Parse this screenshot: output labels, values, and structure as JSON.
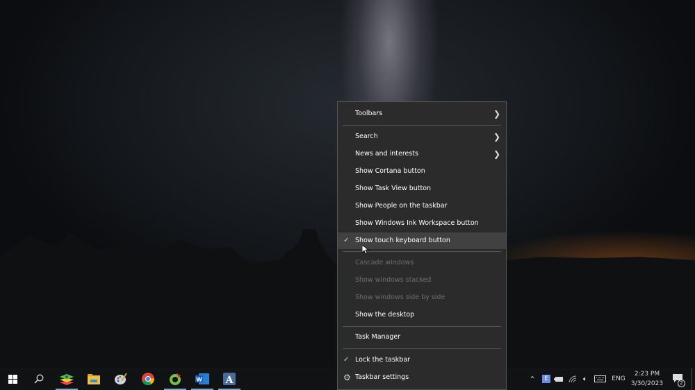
{
  "context_menu": {
    "items": [
      {
        "label": "Toolbars",
        "submenu": true
      },
      {
        "label": "Search",
        "submenu": true
      },
      {
        "label": "News and interests",
        "submenu": true
      },
      {
        "label": "Show Cortana button"
      },
      {
        "label": "Show Task View button"
      },
      {
        "label": "Show People on the taskbar"
      },
      {
        "label": "Show Windows Ink Workspace button"
      },
      {
        "label": "Show touch keyboard button",
        "checked": true,
        "highlighted": true
      },
      {
        "label": "Cascade windows",
        "disabled": true
      },
      {
        "label": "Show windows stacked",
        "disabled": true
      },
      {
        "label": "Show windows side by side",
        "disabled": true
      },
      {
        "label": "Show the desktop"
      },
      {
        "label": "Task Manager"
      },
      {
        "label": "Lock the taskbar",
        "checked": true
      },
      {
        "label": "Taskbar settings",
        "icon": "gear-icon"
      }
    ]
  },
  "taskbar": {
    "apps": [
      "start",
      "search",
      "bluestacks",
      "file-explorer",
      "paint",
      "chrome",
      "greenshot",
      "word",
      "typora"
    ],
    "tray": {
      "language": "ENG",
      "time": "2:23 PM",
      "date": "3/30/2023",
      "notifications": "2"
    }
  },
  "colors": {
    "menu_bg": "#2b2b2b",
    "highlight": "#414141",
    "taskbar": "#101214"
  }
}
